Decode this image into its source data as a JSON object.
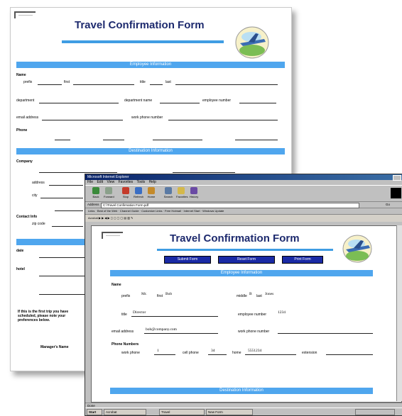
{
  "form": {
    "tag": "————",
    "title": "Travel Confirmation Form"
  },
  "paper": {
    "section1": "Employee Information",
    "section2": "Destination Information",
    "name_label": "Name",
    "prefix": "prefix",
    "first": "first",
    "title_lbl": "title",
    "last": "last",
    "department": "department",
    "department_name": "department name",
    "employee_number": "employee number",
    "email_address": "email address",
    "work_phone": "work phone number",
    "phone": "Phone",
    "company": "Company",
    "address": "address",
    "city": "city",
    "zip": "zip code",
    "contact": "Contact Info",
    "date": "date",
    "hotel": "hotel",
    "notes": "If this is the first trip you have scheduled, please note your preferences below.",
    "signature": "Manager's Name"
  },
  "browser": {
    "window_title": "Microsoft Internet Explorer",
    "menu": [
      "File",
      "Edit",
      "View",
      "Favorites",
      "Tools",
      "Help"
    ],
    "toolbar": [
      "Back",
      "Forward",
      "Stop",
      "Refresh",
      "Home",
      "Search",
      "Favorites",
      "History"
    ],
    "address_label": "Address",
    "address_value": "C:\\Travel Confirmation Form.pdf",
    "go": "Go",
    "links": [
      "Links",
      "Best of the Web",
      "Channel Guide",
      "Customize Links",
      "Free Hotmail",
      "Internet Start",
      "Windows Update"
    ],
    "acrobat_bar": "Acrobat",
    "status": "Done",
    "taskbar": [
      "Start",
      "Acrobat",
      "Travel",
      "New Form"
    ]
  },
  "web_form": {
    "buttons": [
      "Submit Form",
      "Reset Form",
      "Print Form"
    ],
    "section1": "Employee Information",
    "section2": "Destination Information",
    "name_label": "Name",
    "prefix": "prefix",
    "prefix_val": "Mr.",
    "first": "first",
    "first_val": "Bob",
    "middle": "middle",
    "middle_val": "B",
    "last": "last",
    "last_val": "Jones",
    "title_lbl": "title",
    "title_val": "Director",
    "employee_number": "employee number",
    "employee_number_val": "1234",
    "email_address": "email address",
    "email_val": "bob@company.com",
    "work_phone": "work phone number",
    "phone": "Phone Numbers",
    "workphone": "work phone",
    "workphone_val": "1",
    "cellphone": "cell phone",
    "cellphone_val": "34",
    "home": "home",
    "home_val": "5551234",
    "extension": "extension"
  }
}
